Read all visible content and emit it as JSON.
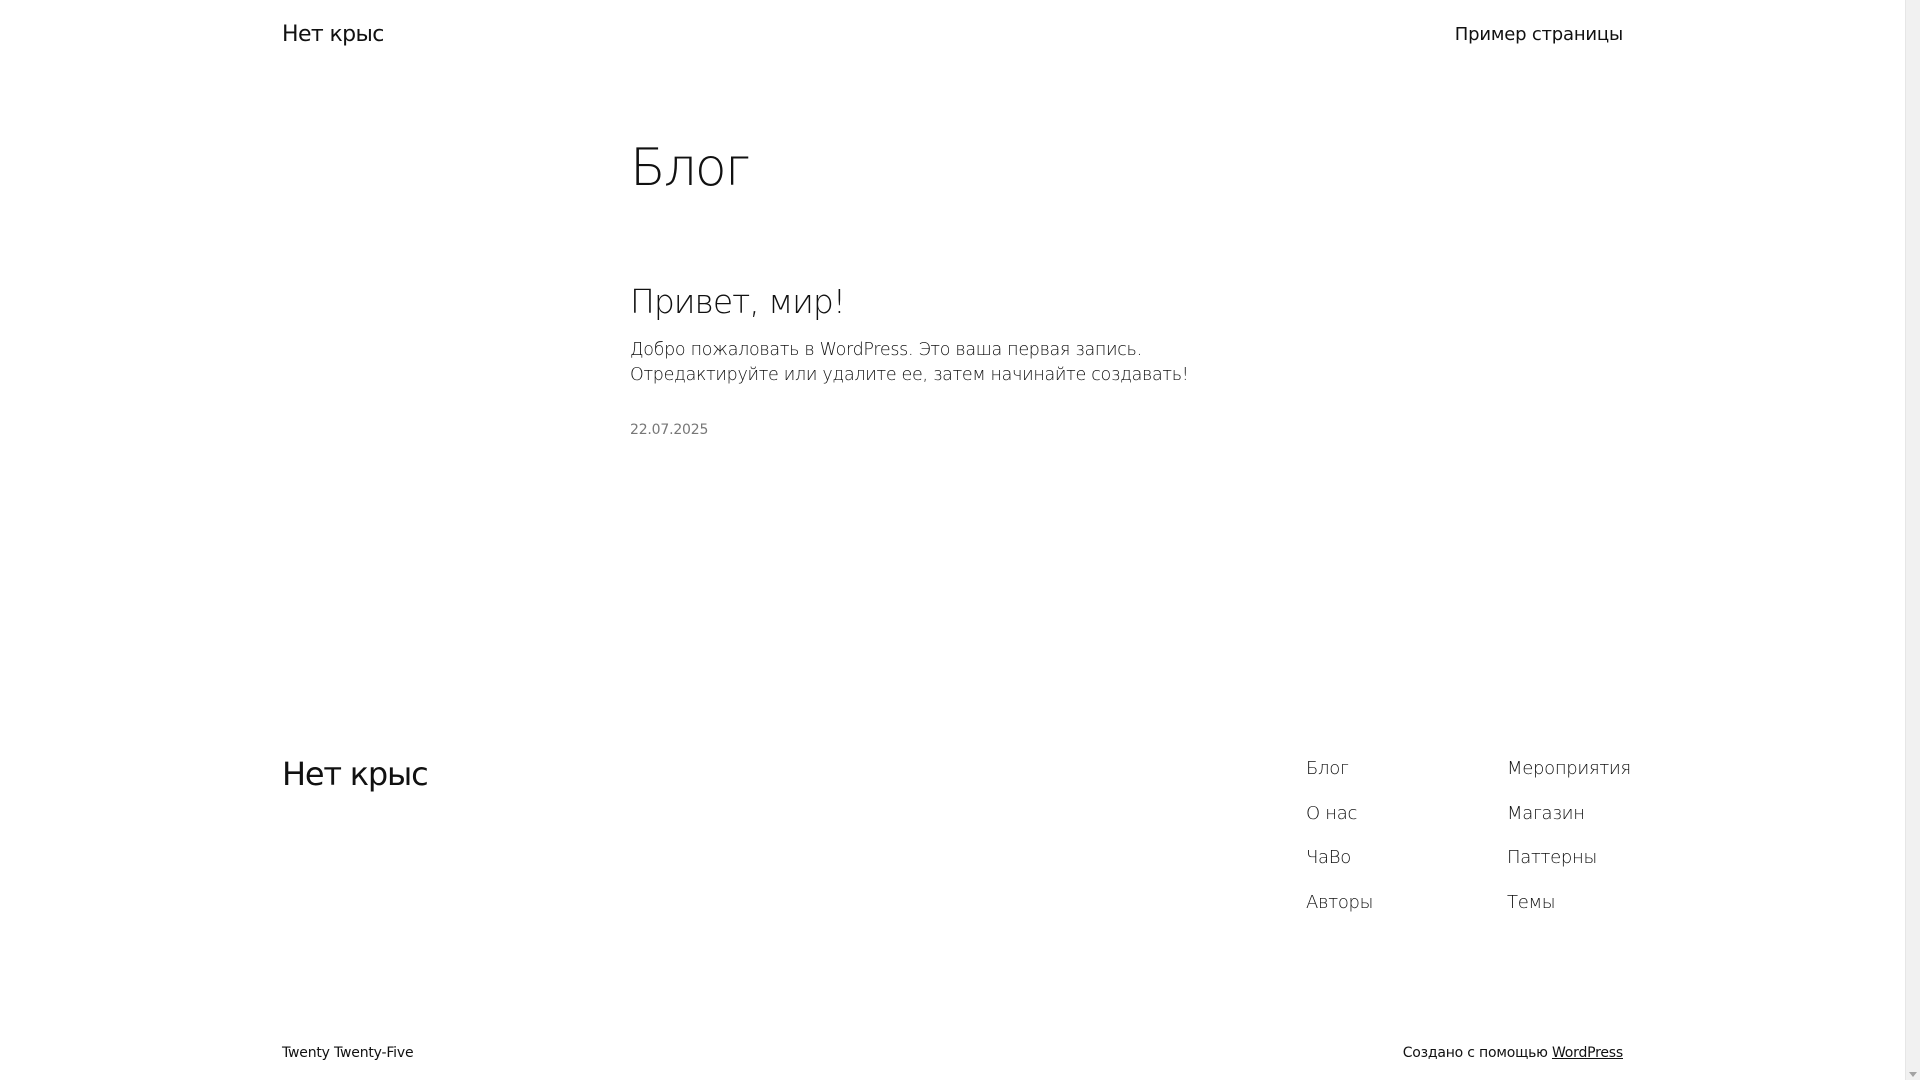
{
  "header": {
    "site_title": "Нет крыс",
    "nav_item": "Пример страницы"
  },
  "main": {
    "heading": "Блог",
    "post": {
      "title": "Привет, мир!",
      "excerpt": "Добро пожаловать в WordPress. Это ваша первая запись. Отредактируйте или удалите ее, затем начинайте создавать!",
      "date": "22.07.2025"
    }
  },
  "footer": {
    "site_title": "Нет крыс",
    "nav_left": [
      "Блог",
      "О нас",
      "ЧаВо",
      "Авторы"
    ],
    "nav_right": [
      "Мероприятия",
      "Магазин",
      "Паттерны",
      "Темы"
    ],
    "theme_credit": "Twenty Twenty-Five",
    "powered_prefix": "Создано с помощью ",
    "powered_link": "WordPress"
  },
  "icons": {
    "scroll_down": "scroll-down-arrow-icon"
  }
}
